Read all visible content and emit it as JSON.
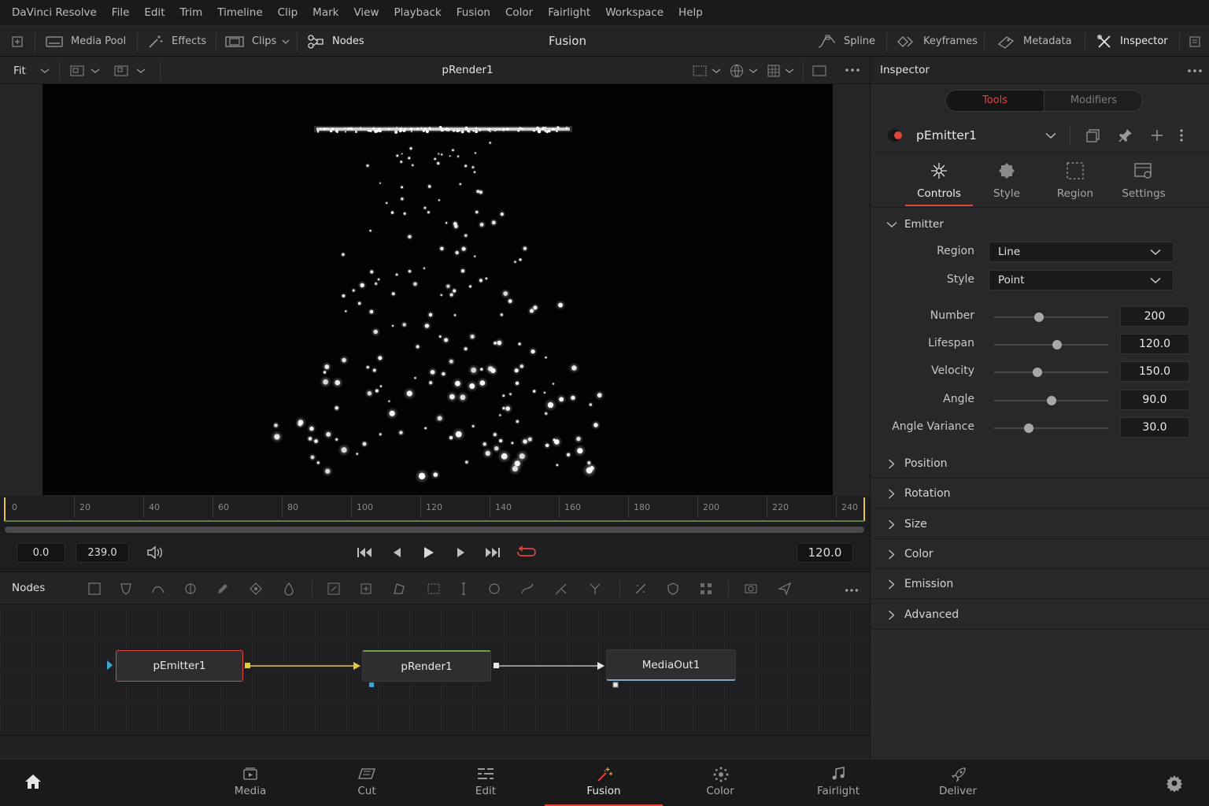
{
  "menu": [
    "DaVinci Resolve",
    "File",
    "Edit",
    "Trim",
    "Timeline",
    "Clip",
    "Mark",
    "View",
    "Playback",
    "Fusion",
    "Color",
    "Fairlight",
    "Workspace",
    "Help"
  ],
  "toolbar": {
    "media_pool": "Media Pool",
    "effects": "Effects",
    "clips": "Clips",
    "nodes": "Nodes",
    "title": "Fusion",
    "spline": "Spline",
    "keyframes": "Keyframes",
    "metadata": "Metadata",
    "inspector": "Inspector"
  },
  "viewer": {
    "zoom": "Fit",
    "title": "pRender1"
  },
  "ruler": {
    "ticks": [
      "0",
      "20",
      "40",
      "60",
      "80",
      "100",
      "120",
      "140",
      "160",
      "180",
      "200",
      "220",
      "240"
    ]
  },
  "transport": {
    "start": "0.0",
    "end": "239.0",
    "current": "120.0"
  },
  "nodes_panel": {
    "title": "Nodes",
    "nodes": [
      "pEmitter1",
      "pRender1",
      "MediaOut1"
    ]
  },
  "inspector": {
    "title": "Inspector",
    "tabs": [
      "Tools",
      "Modifiers"
    ],
    "tool_name": "pEmitter1",
    "subtabs": [
      "Controls",
      "Style",
      "Region",
      "Settings"
    ],
    "section": "Emitter",
    "region_label": "Region",
    "region_value": "Line",
    "style_label": "Style",
    "style_value": "Point",
    "params": [
      {
        "label": "Number",
        "value": "200",
        "slider": 0.39
      },
      {
        "label": "Lifespan",
        "value": "120.0",
        "slider": 0.55
      },
      {
        "label": "Velocity",
        "value": "150.0",
        "slider": 0.38
      },
      {
        "label": "Angle",
        "value": "90.0",
        "slider": 0.5
      },
      {
        "label": "Angle Variance",
        "value": "30.0",
        "slider": 0.3
      }
    ],
    "collapsed_sections": [
      "Position",
      "Rotation",
      "Size",
      "Color",
      "Emission",
      "Advanced"
    ]
  },
  "pages": [
    "Media",
    "Cut",
    "Edit",
    "Fusion",
    "Color",
    "Fairlight",
    "Deliver"
  ],
  "colors": {
    "accent": "#e0453a",
    "node_link": "#e2c93a",
    "render_border": "#6ba34a"
  }
}
